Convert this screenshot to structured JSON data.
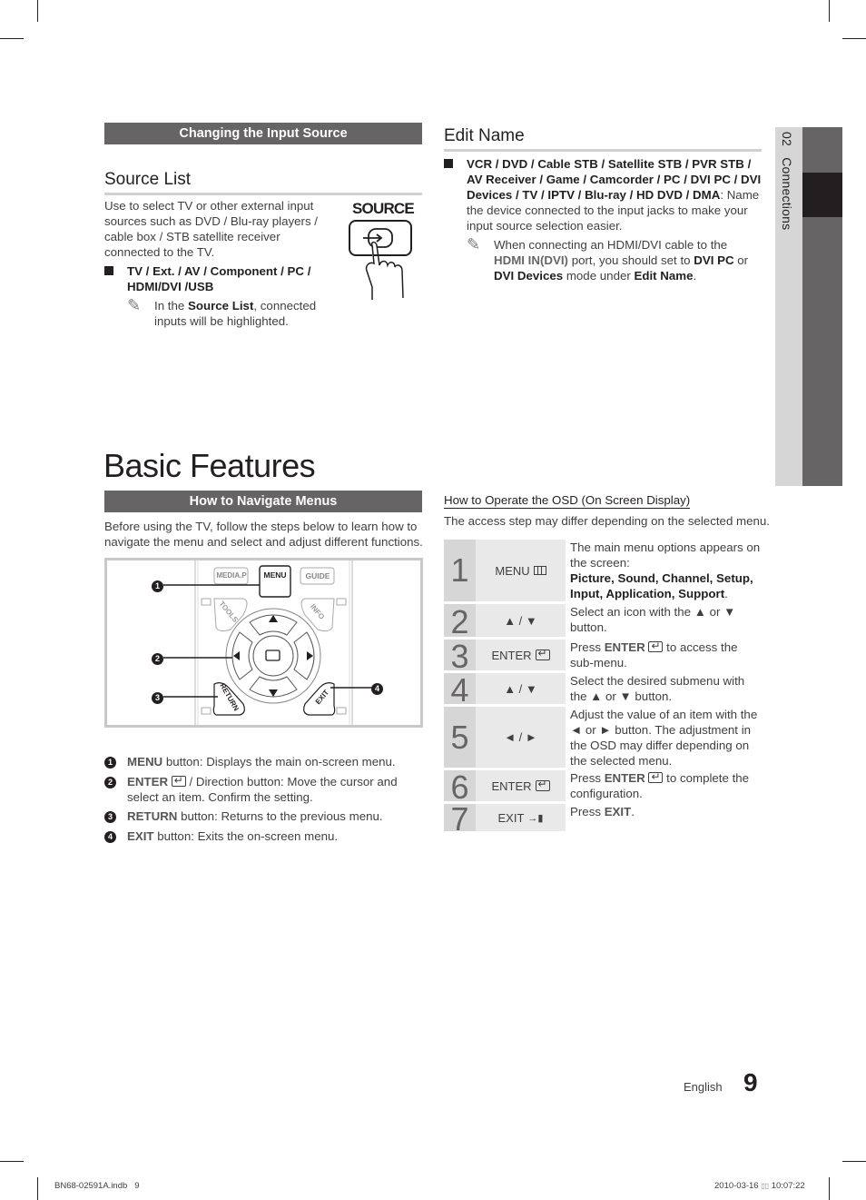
{
  "side_tab": {
    "chapter_number": "02",
    "chapter_title": "Connections",
    "label": "02   Connections"
  },
  "left_top": {
    "section_bar": "Changing the Input Source",
    "heading": "Source List",
    "intro": "Use to select TV or other external input sources such as DVD / Blu-ray players / cable box / STB satellite receiver connected to the TV.",
    "bullet": "TV / Ext. / AV / Component / PC / HDMI/DVI /USB",
    "note_pre": "In the ",
    "note_bold": "Source List",
    "note_post": ", connected inputs will be highlighted.",
    "source_button_label": "SOURCE"
  },
  "right_top": {
    "heading": "Edit Name",
    "bullet_bold": "VCR / DVD / Cable STB / Satellite STB / PVR STB / AV Receiver / Game / Camcorder / PC / DVI PC / DVI Devices / TV / IPTV / Blu-ray / HD DVD / DMA",
    "bullet_rest": ": Name the device connected to the input jacks to make your input source selection easier.",
    "note_1": "When connecting an HDMI/DVI cable to the ",
    "note_port": "HDMI IN(DVI)",
    "note_2": " port, you should set to ",
    "note_bold1": "DVI PC",
    "note_3": " or ",
    "note_bold2": "DVI Devices",
    "note_4": " mode under ",
    "note_bold3": "Edit Name",
    "note_5": "."
  },
  "basic_features": {
    "title": "Basic Features",
    "section_bar": "How to Navigate Menus",
    "intro": "Before using the TV, follow the steps below to learn how to navigate the menu and select and adjust different functions.",
    "remote": {
      "buttons": [
        "MEDIA.P",
        "MENU",
        "GUIDE",
        "TOOLS",
        "INFO",
        "RETURN",
        "EXIT"
      ],
      "callouts": [
        "1",
        "2",
        "3",
        "4"
      ]
    },
    "legend": [
      {
        "num": "1",
        "bold": "MENU",
        "text": " button: Displays the main on-screen menu."
      },
      {
        "num": "2",
        "bold": "ENTER",
        "text": " / Direction button: Move the cursor and select an item. Confirm the setting.",
        "icon": "enter-icon"
      },
      {
        "num": "3",
        "bold": "RETURN",
        "text": " button: Returns to the previous menu."
      },
      {
        "num": "4",
        "bold": "EXIT",
        "text": " button: Exits the on-screen menu."
      }
    ]
  },
  "osd": {
    "title": "How to Operate the OSD (On Screen Display)",
    "subtitle": "The access step may differ depending on the selected menu.",
    "steps": [
      {
        "num": "1",
        "key": "MENU",
        "key_icon": "menu-icon",
        "desc": "The main menu options appears on the screen:",
        "desc_bold": "Picture, Sound, Channel, Setup, Input, Application, Support",
        "desc_end": "."
      },
      {
        "num": "2",
        "key": "▲ / ▼",
        "desc": "Select an icon with the ▲ or ▼ button."
      },
      {
        "num": "3",
        "key": "ENTER",
        "key_icon": "enter-icon",
        "desc_pre": "Press ",
        "desc_bold": "ENTER",
        "desc": " to access the sub-menu."
      },
      {
        "num": "4",
        "key": "▲ / ▼",
        "desc": "Select the desired submenu with the ▲ or ▼ button."
      },
      {
        "num": "5",
        "key": "◄ / ►",
        "desc": "Adjust the value of an item with the ◄ or ► button. The adjustment in the OSD may differ depending on the selected menu."
      },
      {
        "num": "6",
        "key": "ENTER",
        "key_icon": "enter-icon",
        "desc_pre": "Press ",
        "desc_bold": "ENTER",
        "desc": " to complete the configuration."
      },
      {
        "num": "7",
        "key": "EXIT",
        "key_icon": "exit-icon",
        "desc_pre": "Press ",
        "desc_bold": "EXIT",
        "desc": "."
      }
    ]
  },
  "footer": {
    "language": "English",
    "page_number": "9",
    "slug_file": "BN68-02591A.indb   9",
    "slug_date": "2010-03-16",
    "slug_time": "10:07:22"
  }
}
